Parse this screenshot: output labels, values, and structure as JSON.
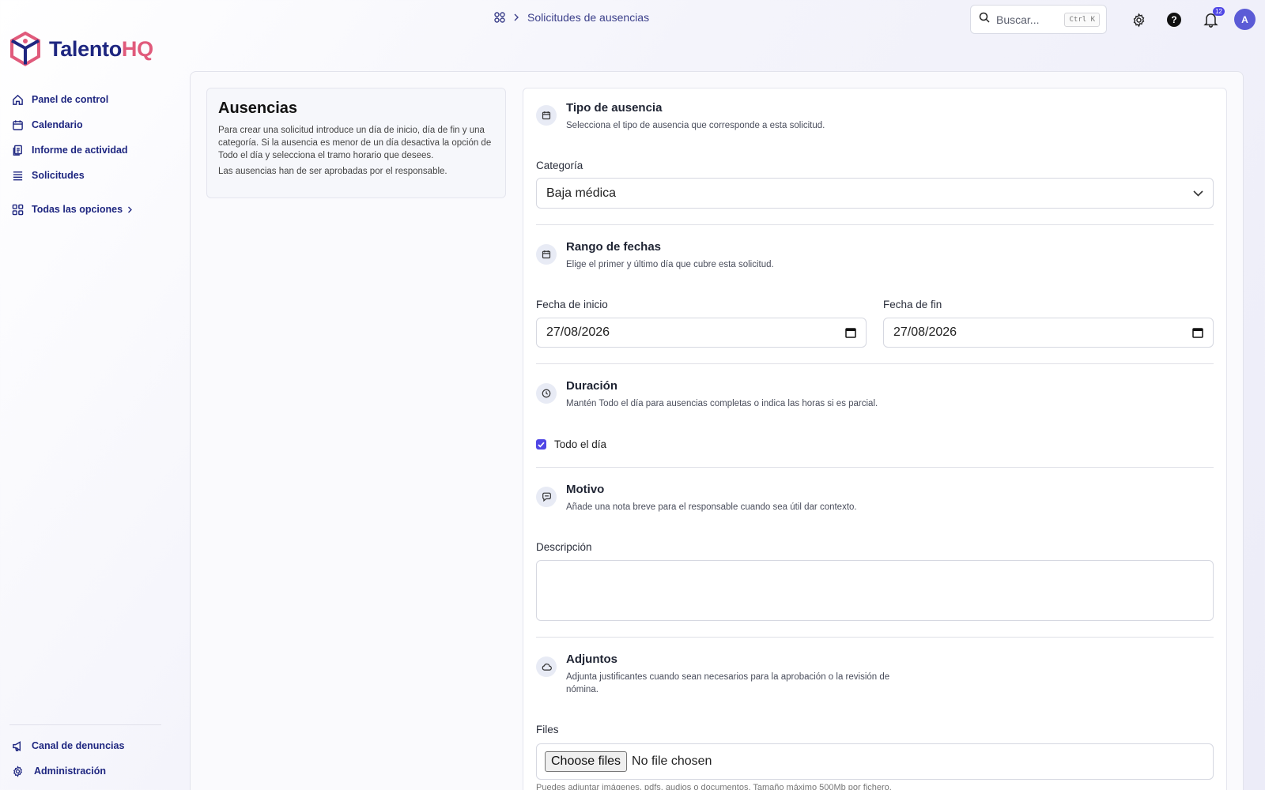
{
  "header": {
    "breadcrumb": "Solicitudes de ausencias",
    "search_placeholder": "Buscar...",
    "search_shortcut": "Ctrl K",
    "notification_count": "12",
    "avatar_initial": "A"
  },
  "brand": {
    "name_main": "Talento",
    "name_accent": "HQ",
    "accent_color": "#e05a7b",
    "primary_color": "#1e2680"
  },
  "sidebar": {
    "items": [
      {
        "label": "Panel de control",
        "icon": "home-icon"
      },
      {
        "label": "Calendario",
        "icon": "calendar-icon"
      },
      {
        "label": "Informe de actividad",
        "icon": "report-icon"
      },
      {
        "label": "Solicitudes",
        "icon": "list-icon"
      }
    ],
    "all_options": "Todas las opciones",
    "bottom": [
      {
        "label": "Canal de denuncias",
        "icon": "megaphone-icon"
      },
      {
        "label": "Administración",
        "icon": "gear-icon"
      }
    ]
  },
  "info": {
    "title": "Ausencias",
    "text1": "Para crear una solicitud introduce un día de inicio, día de fin y una categoría. Si la ausencia es menor de un día desactiva la opción de Todo el día y selecciona el tramo horario que desees.",
    "text2": "Las ausencias han de ser aprobadas por el responsable."
  },
  "form": {
    "type": {
      "title": "Tipo de ausencia",
      "subtitle": "Selecciona el tipo de ausencia que corresponde a esta solicitud.",
      "category_label": "Categoría",
      "category_value": "Baja médica"
    },
    "dates": {
      "title": "Rango de fechas",
      "subtitle": "Elige el primer y último día que cubre esta solicitud.",
      "start_label": "Fecha de inicio",
      "start_value": "27/08/2026",
      "end_label": "Fecha de fin",
      "end_value": "27/08/2026"
    },
    "duration": {
      "title": "Duración",
      "subtitle": "Mantén Todo el día para ausencias completas o indica las horas si es parcial.",
      "all_day_label": "Todo el día",
      "all_day_checked": true
    },
    "reason": {
      "title": "Motivo",
      "subtitle": "Añade una nota breve para el responsable cuando sea útil dar contexto.",
      "description_label": "Descripción",
      "description_value": ""
    },
    "attachments": {
      "title": "Adjuntos",
      "subtitle": "Adjunta justificantes cuando sean necesarios para la aprobación o la revisión de nómina.",
      "files_label": "Files",
      "choose_button": "Choose files",
      "no_file": "No file chosen",
      "hint": "Puedes adjuntar imágenes, pdfs, audios o documentos. Tamaño máximo 500Mb por fichero."
    }
  }
}
